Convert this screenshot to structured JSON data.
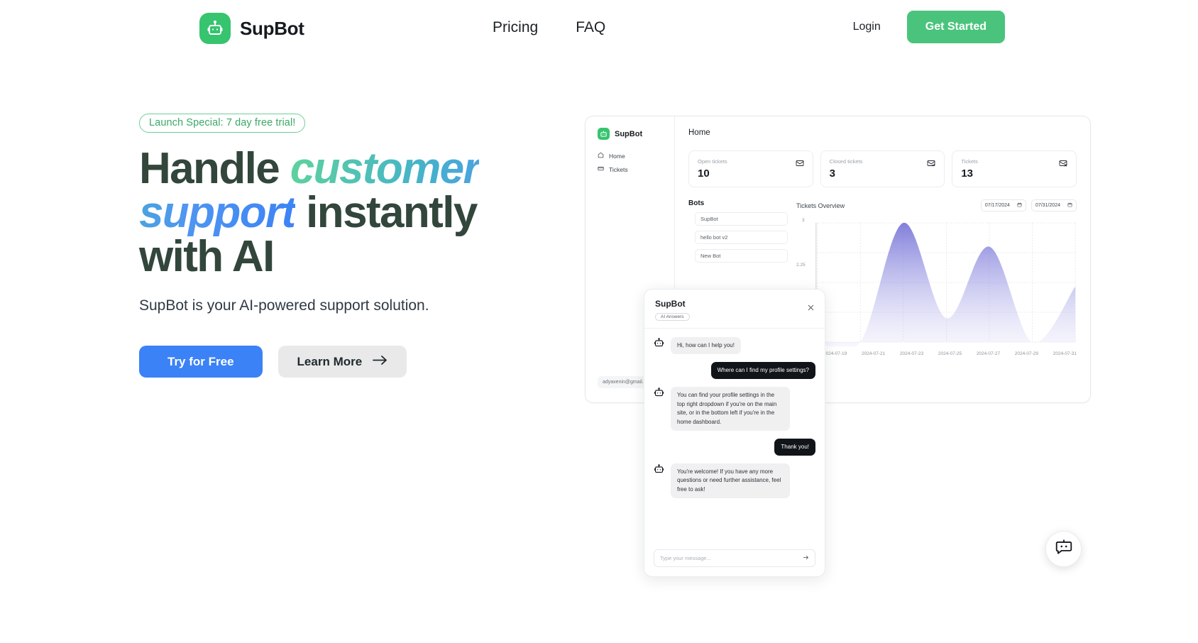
{
  "nav": {
    "brand": "SupBot",
    "logo_icon": "robot-icon",
    "links": [
      {
        "label": "Pricing"
      },
      {
        "label": "FAQ"
      }
    ],
    "login_label": "Login",
    "get_started_label": "Get Started",
    "accent_green": "#4ac47c"
  },
  "hero": {
    "badge": "Launch Special: 7 day free trial!",
    "headline_part1": "Handle ",
    "headline_gradient": "customer support",
    "headline_part2": " instantly with AI",
    "subhead": "SupBot is your AI-powered support solution.",
    "primary_cta": "Try for Free",
    "secondary_cta": "Learn More",
    "secondary_cta_icon": "arrow-right-icon",
    "primary_color": "#3b82f6",
    "headline_color": "#32463c"
  },
  "dashboard": {
    "sidebar": {
      "brand": "SupBot",
      "items": [
        {
          "label": "Home",
          "icon": "home-icon"
        },
        {
          "label": "Tickets",
          "icon": "ticket-icon"
        }
      ],
      "user_email": "adyaxenin@gmail.com"
    },
    "page_title": "Home",
    "stats": [
      {
        "label": "Open tickets",
        "value": "10",
        "icon": "mail-open-icon"
      },
      {
        "label": "Closed tickets",
        "value": "3",
        "icon": "mail-check-icon"
      },
      {
        "label": "Tickets",
        "value": "13",
        "icon": "mail-x-icon"
      }
    ],
    "bots_title": "Bots",
    "bots": [
      {
        "label": "SupBot"
      },
      {
        "label": "hello bot v2"
      },
      {
        "label": "New Bot"
      }
    ],
    "chart": {
      "title": "Tickets Overview",
      "date_from": "07/17/2024",
      "date_to": "07/31/2024",
      "date_icon": "calendar-icon"
    }
  },
  "chart_data": {
    "type": "area",
    "title": "Tickets Overview",
    "xlabel": "",
    "ylabel": "",
    "ylim": [
      0,
      3
    ],
    "yticks": [
      "3",
      "2.25"
    ],
    "grid": true,
    "legend": "none",
    "x": [
      "2024-07-19",
      "2024-07-21",
      "2024-07-23",
      "2024-07-25",
      "2024-07-27",
      "2024-07-29",
      "2024-07-31"
    ],
    "series": [
      {
        "name": "Tickets",
        "values": [
          0,
          0,
          3,
          0.6,
          2.4,
          0,
          1.4
        ]
      }
    ],
    "fill_color": "#7b78d8"
  },
  "chat": {
    "title": "SupBot",
    "badge": "AI Answers",
    "close_icon": "close-icon",
    "bot_icon": "robot-icon",
    "messages": [
      {
        "from": "bot",
        "text": "Hi, how can I help you!"
      },
      {
        "from": "user",
        "text": "Where can I find my profile settings?"
      },
      {
        "from": "bot",
        "text": "You can find your profile settings in the top right dropdown if you're on the main site, or in the bottom left if you're in the home dashboard."
      },
      {
        "from": "user",
        "text": "Thank you!"
      },
      {
        "from": "bot",
        "text": "You're welcome! If you have any more questions or need further assistance, feel free to ask!"
      }
    ],
    "input_placeholder": "Type your message...",
    "send_icon": "arrow-right-icon"
  },
  "fab": {
    "icon": "chat-bot-icon"
  }
}
